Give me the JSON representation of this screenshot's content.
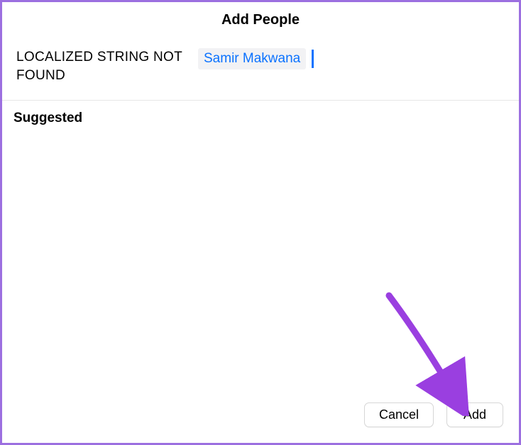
{
  "title": "Add People",
  "field": {
    "label": "LOCALIZED STRING NOT FOUND",
    "token": "Samir Makwana"
  },
  "suggested": {
    "heading": "Suggested"
  },
  "buttons": {
    "cancel": "Cancel",
    "add": "Add"
  }
}
